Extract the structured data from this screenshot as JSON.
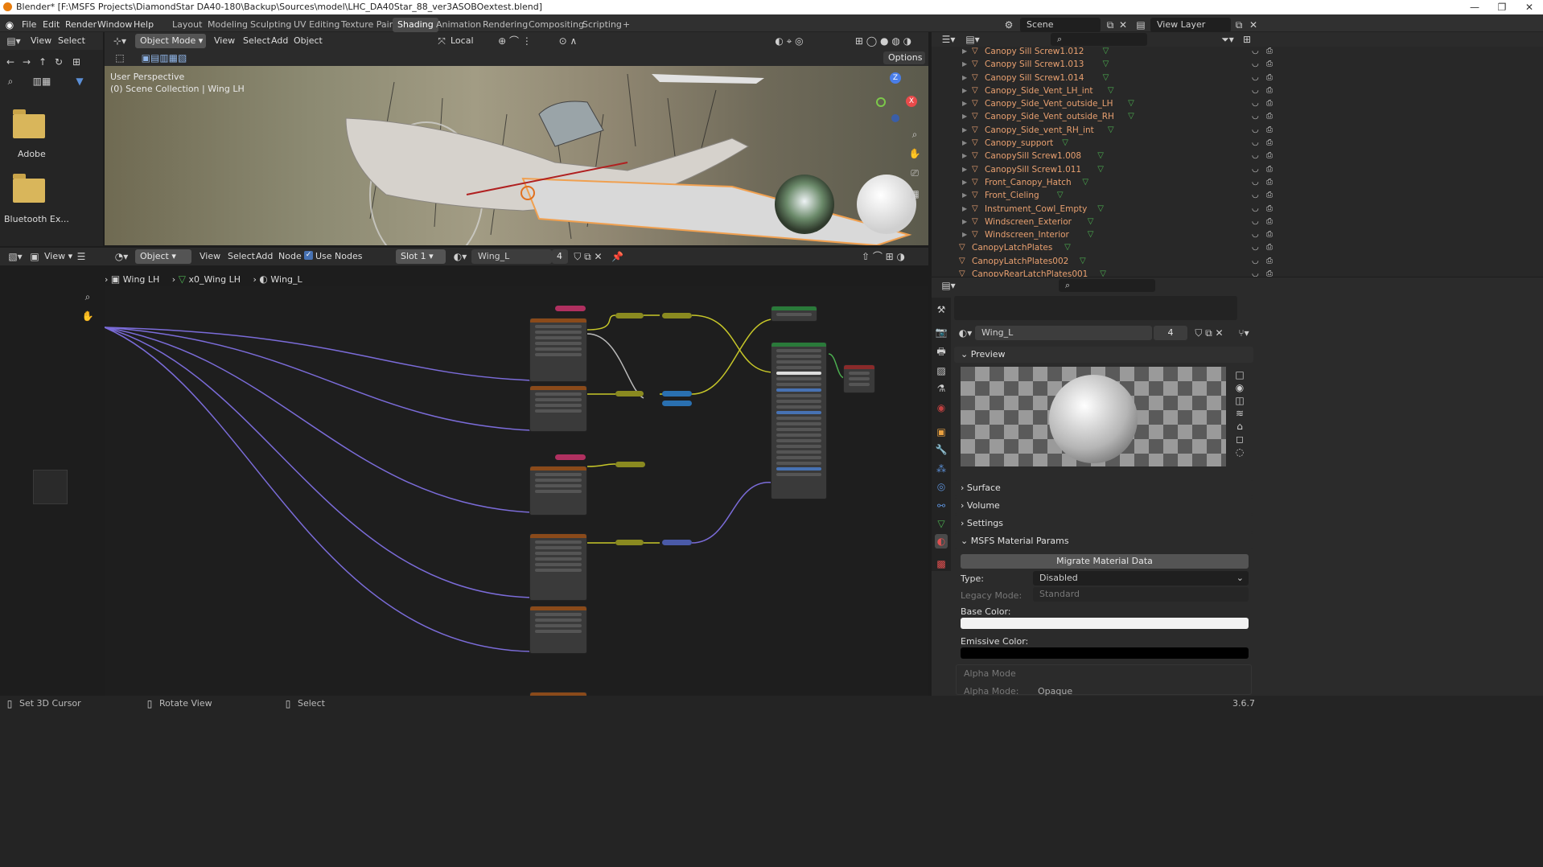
{
  "window": {
    "title": "Blender* [F:\\MSFS Projects\\DiamondStar DA40-180\\Backup\\Sources\\model\\LHC_DA40Star_88_ver3ASOBOextest.blend]",
    "controls": [
      "—",
      "❐",
      "✕"
    ]
  },
  "menubar": {
    "items": [
      "File",
      "Edit",
      "Render",
      "Window",
      "Help"
    ]
  },
  "workspaces": {
    "tabs": [
      "Layout",
      "Modeling",
      "Sculpting",
      "UV Editing",
      "Texture Paint",
      "Shading",
      "Animation",
      "Rendering",
      "Compositing",
      "Scripting"
    ],
    "active": "Shading",
    "add": "+"
  },
  "scene": {
    "label": "Scene",
    "view_layer": "View Layer"
  },
  "filebrowser": {
    "menu": [
      "View",
      "Select"
    ],
    "folders": [
      "Adobe",
      "Bluetooth Ex..."
    ]
  },
  "viewport": {
    "mode": "Object Mode",
    "menu": [
      "View",
      "Select",
      "Add",
      "Object"
    ],
    "orientation": "Local",
    "options": "Options",
    "perspective": "User Perspective",
    "collection": "(0) Scene Collection | Wing LH",
    "gizmo": {
      "z": "Z",
      "x": "X",
      "y": "Y"
    }
  },
  "nodeeditor": {
    "type": "Object",
    "menu": [
      "View",
      "Select",
      "Add",
      "Node"
    ],
    "use_nodes": "Use Nodes",
    "slot": "Slot 1",
    "material": "Wing_L",
    "users": "4",
    "breadcrumb": [
      "Wing LH",
      "x0_Wing LH",
      "Wing_L"
    ]
  },
  "outliner": {
    "items": [
      {
        "name": "Canopy Sill Screw1.012",
        "indent": 1
      },
      {
        "name": "Canopy Sill Screw1.013",
        "indent": 1
      },
      {
        "name": "Canopy Sill Screw1.014",
        "indent": 1
      },
      {
        "name": "Canopy_Side_Vent_LH_int",
        "indent": 1
      },
      {
        "name": "Canopy_Side_Vent_outside_LH",
        "indent": 1
      },
      {
        "name": "Canopy_Side_Vent_outside_RH",
        "indent": 1
      },
      {
        "name": "Canopy_Side_vent_RH_int",
        "indent": 1
      },
      {
        "name": "Canopy_support",
        "indent": 1
      },
      {
        "name": "CanopySill Screw1.008",
        "indent": 1
      },
      {
        "name": "CanopySill Screw1.011",
        "indent": 1
      },
      {
        "name": "Front_Canopy_Hatch",
        "indent": 1
      },
      {
        "name": "Front_Cieling",
        "indent": 1
      },
      {
        "name": "Instrument_Cowl_Empty",
        "indent": 1
      },
      {
        "name": "Windscreen_Exterior",
        "indent": 1
      },
      {
        "name": "Windscreen_Interior",
        "indent": 1
      },
      {
        "name": "CanopyLatchPlates",
        "indent": 0
      },
      {
        "name": "CanopyLatchPlates002",
        "indent": 0
      },
      {
        "name": "CanopyRearLatchPlates001",
        "indent": 0
      }
    ]
  },
  "properties": {
    "material": "Wing_L",
    "users": "4",
    "panels": {
      "preview": "Preview",
      "surface": "Surface",
      "volume": "Volume",
      "settings": "Settings",
      "msfs": "MSFS Material Params"
    },
    "migrate": "Migrate Material Data",
    "type_label": "Type:",
    "type_value": "Disabled",
    "legacy_label": "Legacy Mode:",
    "legacy_value": "Standard",
    "base_color_label": "Base Color:",
    "emissive_label": "Emissive Color:",
    "alpha_mode_header": "Alpha Mode",
    "alpha_mode_label": "Alpha Mode:",
    "alpha_mode_value": "Opaque"
  },
  "statusbar": {
    "items": [
      "Set 3D Cursor",
      "Rotate View",
      "Select"
    ],
    "version": "3.6.7"
  },
  "colors": {
    "accent": "#4772b3",
    "outliner_text": "#e8a070",
    "node_link_purple": "#7b6cd9",
    "node_link_yellow": "#c7c729"
  }
}
